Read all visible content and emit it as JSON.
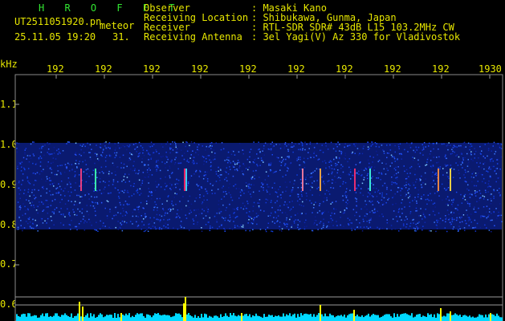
{
  "header": {
    "title": "H R O F F T",
    "filename": "UT2511051920.pn",
    "mode": "meteor",
    "date_time": "25.11.05 19:20",
    "count": "31."
  },
  "meta": {
    "labels": [
      "Observer",
      "Receiving Location",
      "Receiver",
      "Receiving Antenna"
    ],
    "values": [
      ": Masaki Kano",
      ": Shibukawa, Gunma, Japan",
      ": RTL-SDR SDR# 43dB L15 103.2MHz CW",
      ": 3el Yagi(V) Az 330 for Vladivostok"
    ]
  },
  "axes": {
    "y_unit": "kHz",
    "y_ticks": [
      "1.1",
      "1.0",
      "0.9",
      "0.8",
      "0.7",
      "0.6"
    ],
    "x_ticks": [
      "192",
      "192",
      "192",
      "192",
      "192",
      "192",
      "192",
      "192",
      "192",
      "1930"
    ]
  },
  "colors": {
    "text_yellow": "#e6e600",
    "text_green": "#32e632",
    "noise_band": "#1030c0",
    "bar_cyan": "#00e6ff",
    "spike_yellow": "#ffff00"
  }
}
